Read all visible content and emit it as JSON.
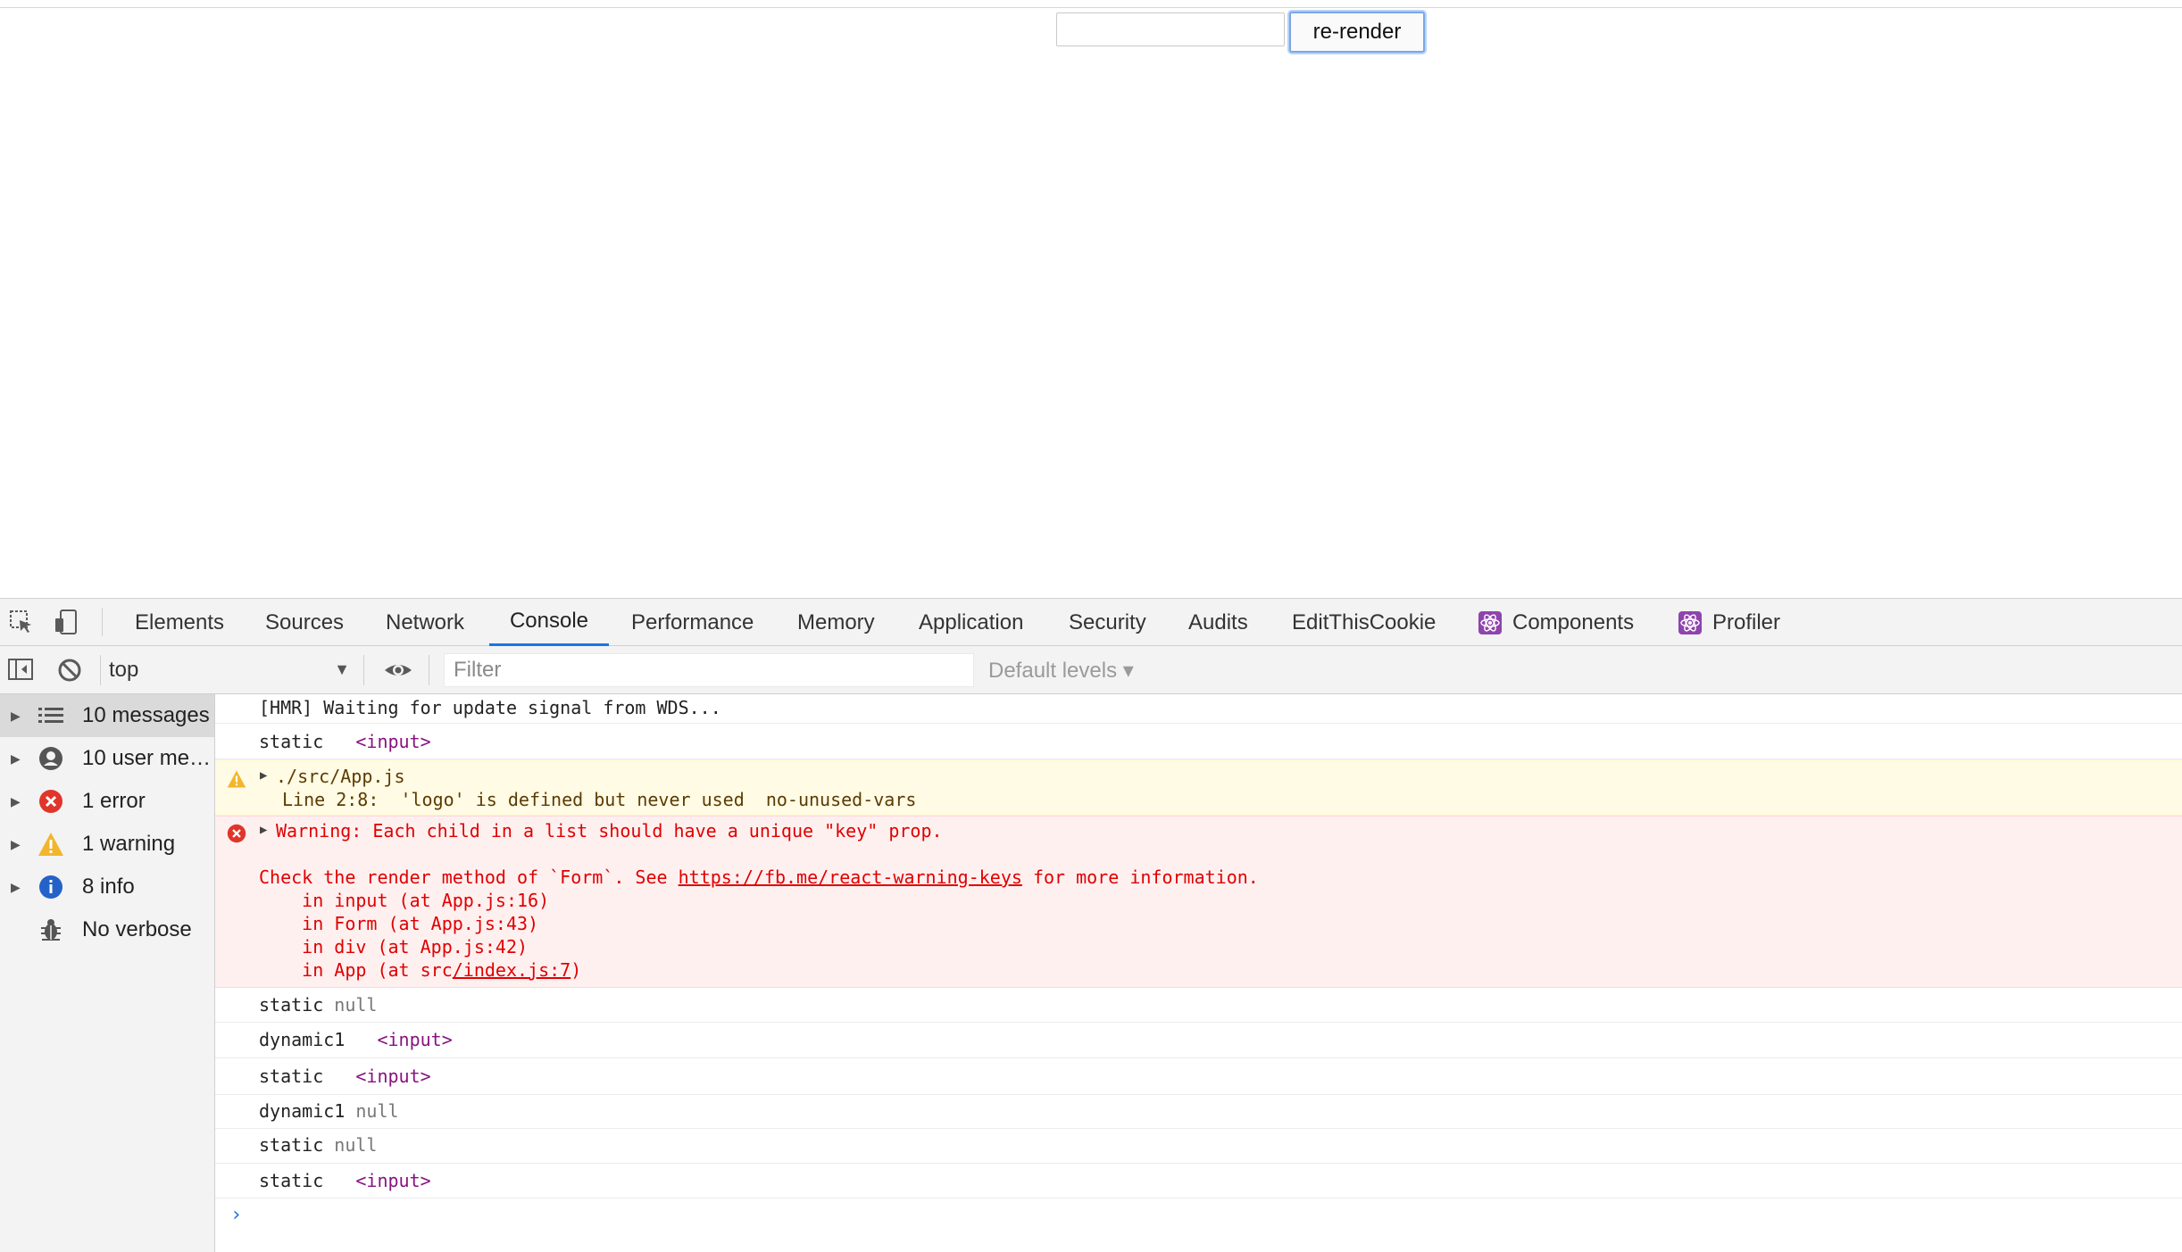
{
  "page": {
    "input_value": "",
    "button_label": "re-render"
  },
  "devtools": {
    "tabs": [
      {
        "label": "Elements"
      },
      {
        "label": "Sources"
      },
      {
        "label": "Network"
      },
      {
        "label": "Console",
        "active": true
      },
      {
        "label": "Performance"
      },
      {
        "label": "Memory"
      },
      {
        "label": "Application"
      },
      {
        "label": "Security"
      },
      {
        "label": "Audits"
      },
      {
        "label": "EditThisCookie"
      },
      {
        "label": "Components",
        "icon": "react-icon"
      },
      {
        "label": "Profiler",
        "icon": "react-icon"
      }
    ],
    "toolbar": {
      "context": "top",
      "filter_placeholder": "Filter",
      "levels": "Default levels ▾"
    },
    "sidebar": [
      {
        "label": "10 messages",
        "icon": "list-icon",
        "selected": true
      },
      {
        "label": "10 user me…",
        "icon": "user-icon"
      },
      {
        "label": "1 error",
        "icon": "error-icon"
      },
      {
        "label": "1 warning",
        "icon": "warning-icon"
      },
      {
        "label": "8 info",
        "icon": "info-icon"
      },
      {
        "label": "No verbose",
        "icon": "bug-icon"
      }
    ],
    "console": {
      "m1": "[HMR] Waiting for update signal from WDS...",
      "m2": {
        "label": "static",
        "tag": "<input>"
      },
      "warn": {
        "line1": "./src/App.js",
        "line2": "Line 2:8:  'logo' is defined but never used  no-unused-vars"
      },
      "err": {
        "line1": "Warning: Each child in a list should have a unique \"key\" prop.",
        "line2_pre": "Check the render method of `Form`. See ",
        "line2_link": "https://fb.me/react-warning-keys",
        "line2_post": " for more information.",
        "line3": "    in input (at App.js:16)",
        "line4": "    in Form (at App.js:43)",
        "line5": "    in div (at App.js:42)",
        "line6_pre": "    in App (at src",
        "line6_link": "/index.js:7",
        "line6_post": ")"
      },
      "m4": {
        "label": "static",
        "value": "null"
      },
      "m5": {
        "label": "dynamic1",
        "tag": "<input>"
      },
      "m6": {
        "label": "static",
        "tag": "<input>"
      },
      "m7": {
        "label": "dynamic1",
        "value": "null"
      },
      "m8": {
        "label": "static",
        "value": "null"
      },
      "m9": {
        "label": "static",
        "tag": "<input>"
      },
      "prompt": "›"
    }
  }
}
